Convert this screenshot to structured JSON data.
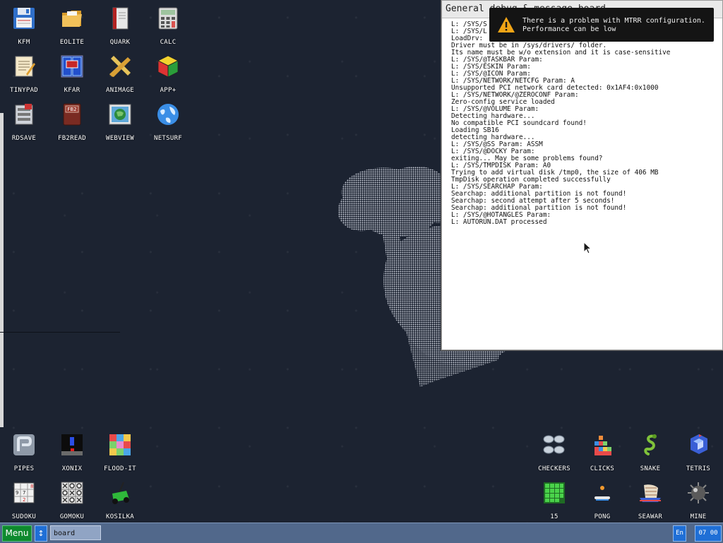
{
  "desktop": {
    "icons_top": [
      {
        "label": "KFM",
        "icon": "floppy-disk-icon"
      },
      {
        "label": "EOLITE",
        "icon": "folder-icon"
      },
      {
        "label": "QUARK",
        "icon": "notebook-icon"
      },
      {
        "label": "CALC",
        "icon": "calculator-icon"
      },
      {
        "label": "TINYPAD",
        "icon": "notepad-icon"
      },
      {
        "label": "KFAR",
        "icon": "dual-panel-icon"
      },
      {
        "label": "ANIMAGE",
        "icon": "pencil-ruler-icon"
      },
      {
        "label": "APP+",
        "icon": "rubik-cube-icon"
      },
      {
        "label": "RDSAVE",
        "icon": "ramdisk-save-icon"
      },
      {
        "label": "FB2READ",
        "icon": "book-icon"
      },
      {
        "label": "WEBVIEW",
        "icon": "web-image-icon"
      },
      {
        "label": "NETSURF",
        "icon": "globe-icon"
      }
    ],
    "icons_bottom_left": [
      {
        "label": "PIPES",
        "icon": "pipes-icon"
      },
      {
        "label": "XONIX",
        "icon": "xonix-icon"
      },
      {
        "label": "FLOOD-IT",
        "icon": "color-grid-icon"
      },
      {
        "label": "SUDOKU",
        "icon": "sudoku-icon"
      },
      {
        "label": "GOMOKU",
        "icon": "tictactoe-icon"
      },
      {
        "label": "KOSILKA",
        "icon": "lawn-mower-icon"
      }
    ],
    "icons_bottom_right": [
      {
        "label": "CHECKERS",
        "icon": "checkers-icon"
      },
      {
        "label": "CLICKS",
        "icon": "blocks-icon"
      },
      {
        "label": "SNAKE",
        "icon": "snake-icon"
      },
      {
        "label": "TETRIS",
        "icon": "tetris-icon"
      },
      {
        "label": "15",
        "icon": "fifteen-puzzle-icon"
      },
      {
        "label": "PONG",
        "icon": "pong-icon"
      },
      {
        "label": "SEAWAR",
        "icon": "ship-icon"
      },
      {
        "label": "MINE",
        "icon": "mine-icon"
      }
    ]
  },
  "debug_window": {
    "title": "General debug & message board",
    "lines": [
      "L: /SYS/S",
      "L: /SYS/L",
      "LoadDrv:",
      "Driver must be in /sys/drivers/ folder.",
      "Its name must be w/o extension and it is case-sensitive",
      "L: /SYS/@TASKBAR Param:",
      "L: /SYS/ESKIN Param:",
      "L: /SYS/@ICON Param:",
      "L: /SYS/NETWORK/NETCFG Param: A",
      "Unsupported PCI network card detected: 0x1AF4:0x1000",
      "L: /SYS/NETWORK/@ZEROCONF Param:",
      "Zero-config service loaded",
      "L: /SYS/@VOLUME Param:",
      "Detecting hardware...",
      "No compatible PCI soundcard found!",
      "Loading SB16",
      "detecting hardware...",
      "L: /SYS/@SS Param: ASSM",
      "L: /SYS/@DOCKY Param:",
      "exiting... May be some problems found?",
      "L: /SYS/TMPDISK Param: A0",
      "Trying to add virtual disk /tmp0, the size of 406 MB",
      "TmpDisk operation completed successfully",
      "L: /SYS/SEARCHAP Param:",
      "Searchap: additional partition is not found!",
      "Searchap: second attempt after 5 seconds!",
      "Searchap: additional partition is not found!",
      "L: /SYS/@HOTANGLES Param:",
      "L: AUTORUN.DAT processed"
    ]
  },
  "notification": {
    "line1": "There is a problem with MTRR configuration.",
    "line2": "Performance can be low",
    "icon": "warning-icon"
  },
  "taskbar": {
    "menu_label": "Menu",
    "switch_glyph": "↕",
    "task_label": "board",
    "language": "En",
    "clock": "07 00"
  },
  "colors": {
    "desktop_bg": "#1c2331",
    "taskbar_bg": "#51688b",
    "menu_green": "#0e8a2e",
    "tray_blue": "#1f6fd6"
  }
}
